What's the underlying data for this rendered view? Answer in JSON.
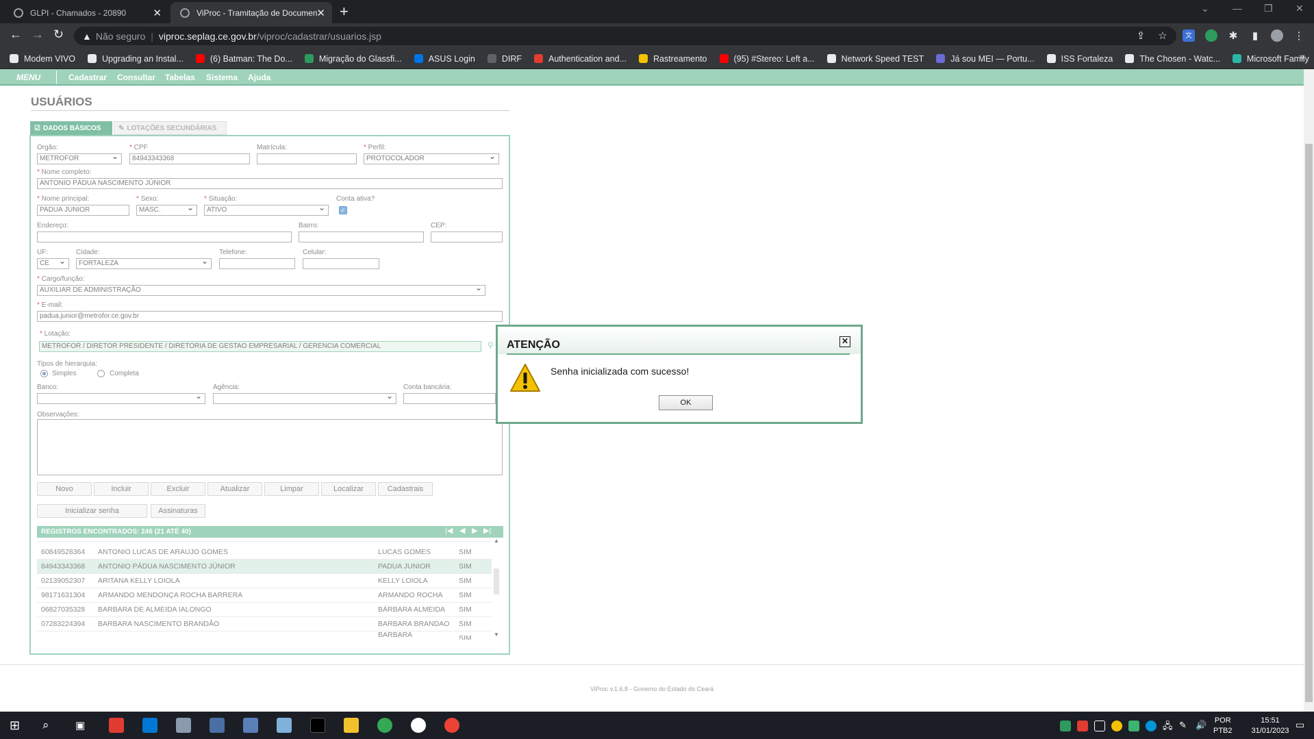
{
  "browser": {
    "tabs": [
      {
        "title": "GLPI - Chamados - 20890"
      },
      {
        "title": "ViProc - Tramitação de Documen"
      }
    ],
    "security": "Não seguro",
    "url_host": "viproc.seplag.ce.gov.br",
    "url_path": "/viproc/cadastrar/usuarios.jsp",
    "bookmarks": [
      "Modem VIVO",
      "Upgrading an Instal...",
      "(6) Batman: The Do...",
      "Migração do Glassfi...",
      "ASUS Login",
      "DIRF",
      "Authentication and...",
      "Rastreamento",
      "(95) #Stereo: Left a...",
      "Network Speed TEST",
      "Já sou MEI — Portu...",
      "ISS Fortaleza",
      "The Chosen - Watc...",
      "Microsoft Family"
    ]
  },
  "menu": {
    "label": "MENU",
    "items": [
      "Cadastrar",
      "Consultar",
      "Tabelas",
      "Sistema",
      "Ajuda"
    ]
  },
  "page": {
    "title": "USUÁRIOS",
    "tabs": [
      "DADOS BÁSICOS",
      "LOTAÇÕES SECUNDÁRIAS"
    ]
  },
  "form": {
    "orgao": {
      "label": "Orgão:",
      "value": "METROFOR"
    },
    "cpf": {
      "label": "CPF",
      "value": "84943343368"
    },
    "matricula": {
      "label": "Matrícula:",
      "value": ""
    },
    "perfil": {
      "label": "Perfil:",
      "value": "PROTOCOLADOR"
    },
    "nome_completo": {
      "label": "Nome completo:",
      "value": "ANTONIO PÁDUA NASCIMENTO JÚNIOR"
    },
    "nome_principal": {
      "label": "Nome principal:",
      "value": "PADUA JUNIOR"
    },
    "sexo": {
      "label": "Sexo:",
      "value": "MASC."
    },
    "situacao": {
      "label": "Situação:",
      "value": "ATIVO"
    },
    "conta_ativa": {
      "label": "Conta ativa?",
      "checked": true
    },
    "endereco": {
      "label": "Endereço:",
      "value": ""
    },
    "bairro": {
      "label": "Bairro:",
      "value": ""
    },
    "cep": {
      "label": "CEP:",
      "value": ""
    },
    "uf": {
      "label": "UF:",
      "value": "CE"
    },
    "cidade": {
      "label": "Cidade:",
      "value": "FORTALEZA"
    },
    "telefone": {
      "label": "Telefone:",
      "value": ""
    },
    "celular": {
      "label": "Celular:",
      "value": ""
    },
    "cargo": {
      "label": "Cargo/função:",
      "value": "AUXILIAR DE ADMINISTRAÇÃO"
    },
    "email": {
      "label": "E-mail:",
      "value": "padua.junior@metrofor.ce.gov.br"
    },
    "lotacao": {
      "label": "Lotação:",
      "value": "METROFOR / DIRETOR PRESIDENTE / DIRETORIA DE GESTAO EMPRESARIAL / GERENCIA COMERCIAL"
    },
    "hierarquia": {
      "label": "Tipos de hierarquia:",
      "options": [
        "Simples",
        "Completa"
      ],
      "selected": "Simples"
    },
    "banco": {
      "label": "Banco:",
      "value": ""
    },
    "agencia": {
      "label": "Agência:",
      "value": ""
    },
    "conta_bancaria": {
      "label": "Conta bancária:",
      "value": ""
    },
    "observacoes": {
      "label": "Observações:",
      "value": ""
    }
  },
  "buttons": [
    "Novo",
    "Incluir",
    "Excluir",
    "Atualizar",
    "Limpar",
    "Localizar",
    "Cadastrais"
  ],
  "buttons2": [
    "Inicializar senha",
    "Assinaturas"
  ],
  "grid": {
    "header": "REGISTROS ENCONTRADOS: 246 (21 ATÉ 40)",
    "rows": [
      {
        "cpf": "60849528364",
        "nome": "ANTONIO LUCAS DE ARAUJO GOMES",
        "principal": "LUCAS GOMES",
        "ativo": "SIM"
      },
      {
        "cpf": "84943343368",
        "nome": "ANTONIO PÁDUA NASCIMENTO JÚNIOR",
        "principal": "PADUA JUNIOR",
        "ativo": "SIM"
      },
      {
        "cpf": "02139052307",
        "nome": "ARITANA KELLY LOIOLA",
        "principal": "KELLY LOIOLA",
        "ativo": "SIM"
      },
      {
        "cpf": "98171631304",
        "nome": "ARMANDO MENDONÇA ROCHA BARRERA",
        "principal": "ARMANDO ROCHA",
        "ativo": "SIM"
      },
      {
        "cpf": "06827035328",
        "nome": "BARBARA DE ALMEIDA IALONGO",
        "principal": "BÁRBARA ALMEIDA",
        "ativo": "SIM"
      },
      {
        "cpf": "07283224394",
        "nome": "BARBARA NASCIMENTO BRANDÃO",
        "principal": "BARBARA BRANDAO",
        "ativo": "SIM"
      }
    ],
    "partial_bottom": {
      "principal": "BARBARA",
      "ativo": "SIM"
    }
  },
  "footer": "ViProc v.1.6.8 - Governo do Estado do Ceará",
  "dialog": {
    "title": "ATENÇÃO",
    "message": "Senha inicializada com sucesso!",
    "ok": "OK"
  },
  "taskbar": {
    "lang1": "POR",
    "lang2": "PTB2",
    "time": "15:51",
    "date": "31/01/2023"
  },
  "colors": {
    "accent": "#9fd3bb",
    "dialog_border": "#6fa88c"
  }
}
